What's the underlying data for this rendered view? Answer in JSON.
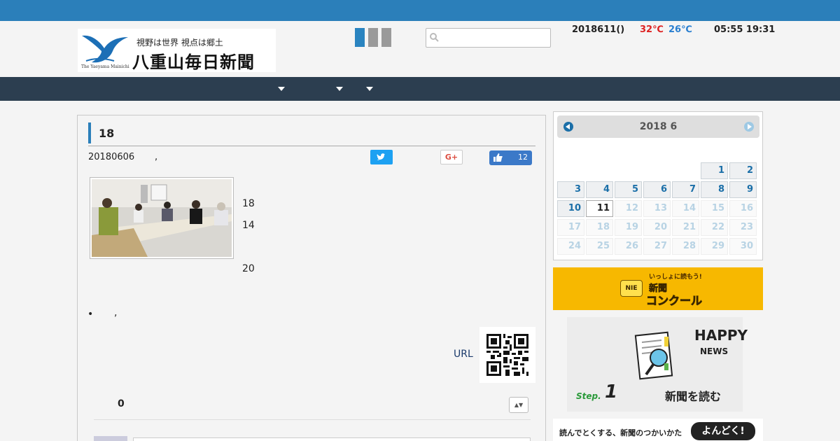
{
  "header": {
    "tagline": "視野は世界  視点は郷土",
    "site_name": "八重山毎日新聞",
    "site_name_en": "The Yaeyama Mainichi",
    "search_placeholder": "",
    "date": "2018611()",
    "temp_high": "32℃",
    "temp_low": "26℃",
    "sunrise": "05:55",
    "sunset": "19:31"
  },
  "article": {
    "title": "18",
    "date": "20180606",
    "meta_sep": ",",
    "fb_count": "12",
    "gplus_label": "G+",
    "paragraphs": [
      "18",
      "14",
      "20"
    ],
    "bullet_text": ",",
    "url_label": "URL",
    "comment_count": "0",
    "sort_label": "▲▼"
  },
  "calendar": {
    "title": "2018 6",
    "days": [
      "1",
      "2",
      "3",
      "4",
      "5",
      "6",
      "7",
      "8",
      "9",
      "10",
      "11",
      "12",
      "13",
      "14",
      "15",
      "16",
      "17",
      "18",
      "19",
      "20",
      "21",
      "22",
      "23",
      "24",
      "25",
      "26",
      "27",
      "28",
      "29",
      "30"
    ],
    "today": "11"
  },
  "banners": {
    "nie_top": "いっしょに読もう!",
    "nie_mid": "新聞",
    "nie_bottom": "コンクール",
    "nie_badge": "NIE",
    "happy_title": "HAPPY",
    "happy_sub": "NEWS",
    "step_label": "Step.",
    "step_number": "1",
    "read_label": "新聞を読む",
    "yondoku_text": "読んでとくする、新聞のつかいかた",
    "yondoku_badge": "よんどく!"
  },
  "colors": {
    "topbar": "#2b7fba",
    "nav": "#2c3e50",
    "temp_high": "#dd2222",
    "temp_low": "#2a7fd0",
    "accent": "#1b6fa8"
  }
}
